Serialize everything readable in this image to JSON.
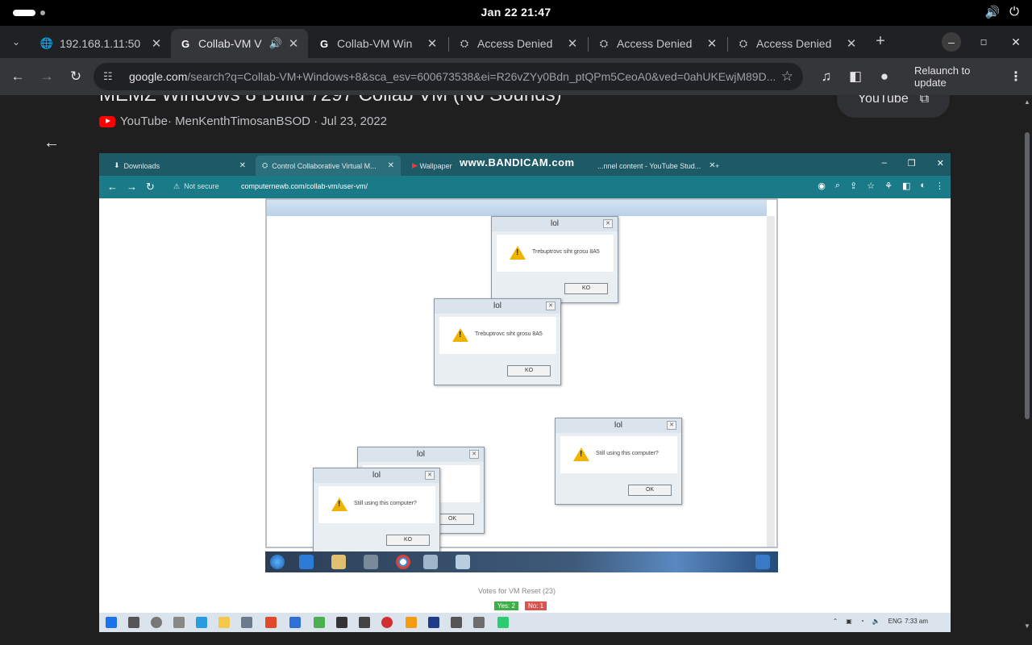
{
  "system": {
    "clock": "Jan 22  21:47",
    "volume_icon": "volume-icon",
    "power_icon": "power-icon"
  },
  "tabs": [
    {
      "title": "192.168.1.11:50",
      "icon": "globe-icon",
      "active": false
    },
    {
      "title": "Collab-VM V",
      "icon": "google-icon",
      "active": true,
      "audio": "speaker-icon"
    },
    {
      "title": "Collab-VM Win",
      "icon": "google-icon",
      "active": false
    },
    {
      "title": "Access Denied",
      "icon": "vm-icon",
      "active": false
    },
    {
      "title": "Access Denied",
      "icon": "vm-icon",
      "active": false
    },
    {
      "title": "Access Denied",
      "icon": "vm-icon",
      "active": false
    }
  ],
  "toolbar": {
    "url_host": "google.com",
    "url_rest": "/search?q=Collab-VM+Windows+8&sca_esv=600673538&ei=R26vZYy0Bdn_ptQPm5CeoA0&ved=0ahUKEwjM89D...",
    "relaunch_label": "Relaunch to update"
  },
  "result": {
    "title": "MEMZ Windows 8 Build 7297 Collab VM (No Sounds)",
    "source": "YouTube",
    "meta": " · MenKenthTimosanBSOD · Jul 23, 2022",
    "yt_button": "YouTube"
  },
  "video": {
    "tabs": [
      "Downloads",
      "Control Collaborative Virtual M...",
      "Wallpaper",
      "...nnel content - YouTube Stud..."
    ],
    "bandicam": "www.BANDICAM.com",
    "not_secure": "Not secure",
    "url": "computernewb.com/collab-vm/user-vm/",
    "dialogs": [
      {
        "title": "lol",
        "message": "Trebuptrovc siht grosu 8A5",
        "ok": "KO"
      },
      {
        "title": "lol",
        "message": "Trebuptrovc siht grosu 8A5",
        "ok": "KO"
      },
      {
        "title": "lol",
        "message": "Still using this computer?",
        "ok": "OK"
      },
      {
        "title": "lol",
        "message": "",
        "ok": "OK"
      },
      {
        "title": "lol",
        "message": "Still using this computer?",
        "ok": "KO"
      }
    ],
    "votes_label": "Votes for VM Reset (23)",
    "vote_yes": "Yes: 2",
    "vote_no": "No: 1",
    "tray_lang": "ENG",
    "tray_time": "7:33 am"
  }
}
